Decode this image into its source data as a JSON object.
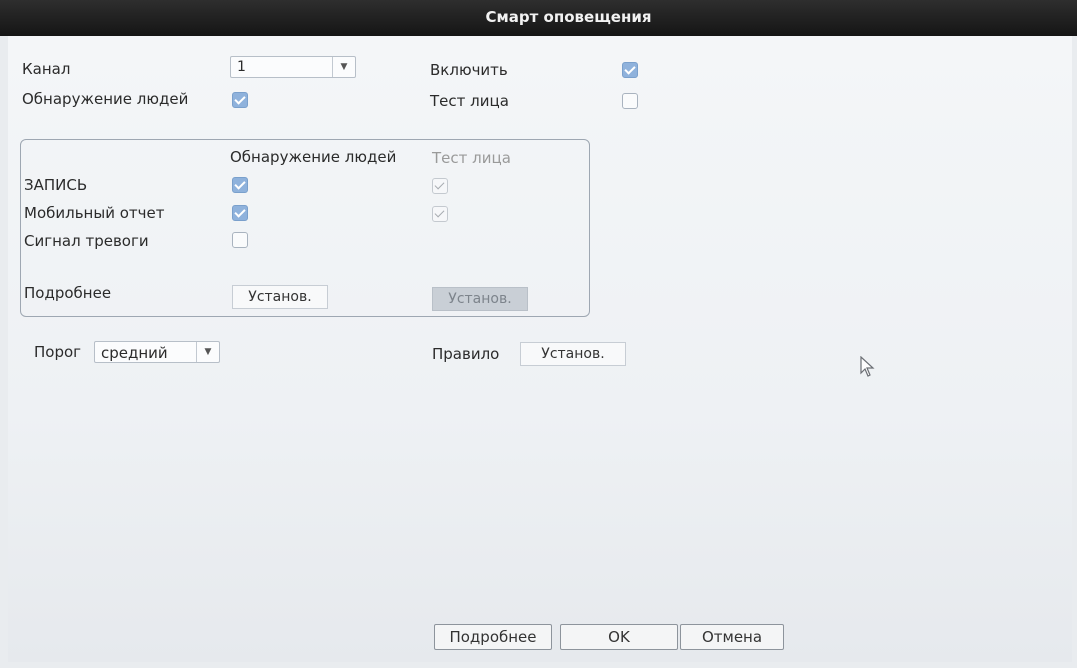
{
  "window": {
    "title": "Смарт оповещения"
  },
  "top": {
    "channel_label": "Канал",
    "channel_value": "1",
    "people_detection_label": "Обнаружение людей",
    "people_detection_checked": true,
    "enable_label": "Включить",
    "enable_checked": true,
    "face_test_label": "Тест лица",
    "face_test_checked": false
  },
  "group": {
    "col_people": "Обнаружение людей",
    "col_face": "Тест лица",
    "rows": [
      {
        "label": "ЗАПИСЬ",
        "people": true,
        "face": true
      },
      {
        "label": "Мобильный отчет",
        "people": true,
        "face": true
      },
      {
        "label": "Сигнал тревоги",
        "people": false
      }
    ],
    "details_label": "Подробнее",
    "set_people": "Установ.",
    "set_face": "Установ."
  },
  "threshold": {
    "label": "Порог",
    "value": "средний"
  },
  "rule": {
    "label": "Правило",
    "button": "Установ."
  },
  "footer": {
    "details": "Подробнее",
    "ok": "OK",
    "cancel": "Отмена"
  }
}
